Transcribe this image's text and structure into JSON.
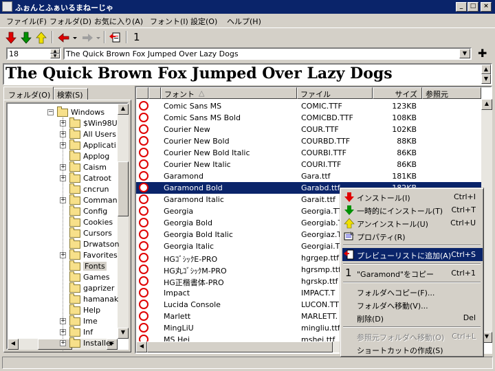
{
  "window": {
    "title": "ふぉんとふぁいるまねーじゃ"
  },
  "menubar": [
    "ファイル(F)",
    "フォルダ(D)",
    "お気に入り(A)",
    "フォント(I)",
    "設定(O)",
    "ヘルプ(H)"
  ],
  "toolbar": {
    "counter": "1"
  },
  "size_field": {
    "value": "18"
  },
  "preview_field": {
    "value": "The Quick Brown Fox Jumped Over Lazy Dogs"
  },
  "preview": {
    "text": "The Quick Brown Fox Jumped Over Lazy Dogs"
  },
  "tabs": {
    "folder": "フォルダ(O)",
    "search": "検索(S)"
  },
  "tree": [
    {
      "label": "Windows",
      "expander": "minus"
    },
    {
      "label": "$Win98U",
      "expander": "plus"
    },
    {
      "label": "All Users",
      "expander": "plus"
    },
    {
      "label": "Applicati",
      "expander": "plus"
    },
    {
      "label": "Applog",
      "expander": "none"
    },
    {
      "label": "Caism",
      "expander": "plus"
    },
    {
      "label": "Catroot",
      "expander": "plus"
    },
    {
      "label": "cncrun",
      "expander": "none"
    },
    {
      "label": "Comman",
      "expander": "plus"
    },
    {
      "label": "Config",
      "expander": "none"
    },
    {
      "label": "Cookies",
      "expander": "none"
    },
    {
      "label": "Cursors",
      "expander": "none"
    },
    {
      "label": "Drwatson",
      "expander": "none"
    },
    {
      "label": "Favorites",
      "expander": "plus"
    },
    {
      "label": "Fonts",
      "expander": "none"
    },
    {
      "label": "Games",
      "expander": "none"
    },
    {
      "label": "gaprizer",
      "expander": "none"
    },
    {
      "label": "hamanak",
      "expander": "none"
    },
    {
      "label": "Help",
      "expander": "none"
    },
    {
      "label": "Ime",
      "expander": "plus"
    },
    {
      "label": "Inf",
      "expander": "plus"
    },
    {
      "label": "Installer",
      "expander": "plus"
    }
  ],
  "columns": {
    "font": "フォント",
    "file": "ファイル",
    "size": "サイズ",
    "ref": "参照元"
  },
  "fonts": [
    {
      "name": "Comic Sans MS",
      "file": "COMIC.TTF",
      "size": "123KB"
    },
    {
      "name": "Comic Sans MS Bold",
      "file": "COMICBD.TTF",
      "size": "108KB"
    },
    {
      "name": "Courier New",
      "file": "COUR.TTF",
      "size": "102KB"
    },
    {
      "name": "Courier New Bold",
      "file": "COURBD.TTF",
      "size": "88KB"
    },
    {
      "name": "Courier New Bold Italic",
      "file": "COURBI.TTF",
      "size": "86KB"
    },
    {
      "name": "Courier New Italic",
      "file": "COURI.TTF",
      "size": "86KB"
    },
    {
      "name": "Garamond",
      "file": "Gara.ttf",
      "size": "181KB"
    },
    {
      "name": "Garamond Bold",
      "file": "Garabd.ttf",
      "size": "182KB"
    },
    {
      "name": "Garamond Italic",
      "file": "Garait.ttf",
      "size": ""
    },
    {
      "name": "Georgia",
      "file": "Georgia.TT",
      "size": ""
    },
    {
      "name": "Georgia Bold",
      "file": "Georgiab.T",
      "size": ""
    },
    {
      "name": "Georgia Bold Italic",
      "file": "Georgiaz.T",
      "size": ""
    },
    {
      "name": "Georgia Italic",
      "file": "Georgiai.T",
      "size": ""
    },
    {
      "name": "HGｺﾞｼｯｸE-PRO",
      "file": "hgrgep.ttf",
      "size": ""
    },
    {
      "name": "HG丸ｺﾞｼｯｸM-PRO",
      "file": "hgrsmp.ttf",
      "size": ""
    },
    {
      "name": "HG正楷書体-PRO",
      "file": "hgrskp.ttf",
      "size": ""
    },
    {
      "name": "Impact",
      "file": "IMPACT.T",
      "size": ""
    },
    {
      "name": "Lucida Console",
      "file": "LUCON.TT",
      "size": ""
    },
    {
      "name": "Marlett",
      "file": "MARLETT.",
      "size": ""
    },
    {
      "name": "MingLiU",
      "file": "mingliu.ttf",
      "size": ""
    },
    {
      "name": "MS Hei",
      "file": "mshei.ttf",
      "size": ""
    }
  ],
  "context_menu": {
    "install": {
      "label": "インストール(I)",
      "key": "Ctrl+I"
    },
    "temp_install": {
      "label": "一時的にインストール(T)",
      "key": "Ctrl+T"
    },
    "uninstall": {
      "label": "アンインストール(U)",
      "key": "Ctrl+U"
    },
    "properties": {
      "label": "プロパティ(R)",
      "key": ""
    },
    "add_preview": {
      "label": "プレビューリストに追加(A)",
      "key": "Ctrl+S"
    },
    "copy_name": {
      "label": "\"Garamond\"をコピー",
      "key": "Ctrl+1",
      "glyph": "1"
    },
    "copy_folder": {
      "label": "フォルダへコピー(F)...",
      "key": ""
    },
    "move_folder": {
      "label": "フォルダへ移動(V)...",
      "key": ""
    },
    "delete": {
      "label": "削除(D)",
      "key": "Del"
    },
    "move_ref": {
      "label": "参照元フォルダへ移動(O)",
      "key": "Ctrl+L"
    },
    "shortcut": {
      "label": "ショートカットの作成(S)",
      "key": ""
    }
  },
  "colors": {
    "title_bg": "#0a246a",
    "face": "#d4d0c8",
    "install_red": "#e00000",
    "install_green": "#009000"
  }
}
